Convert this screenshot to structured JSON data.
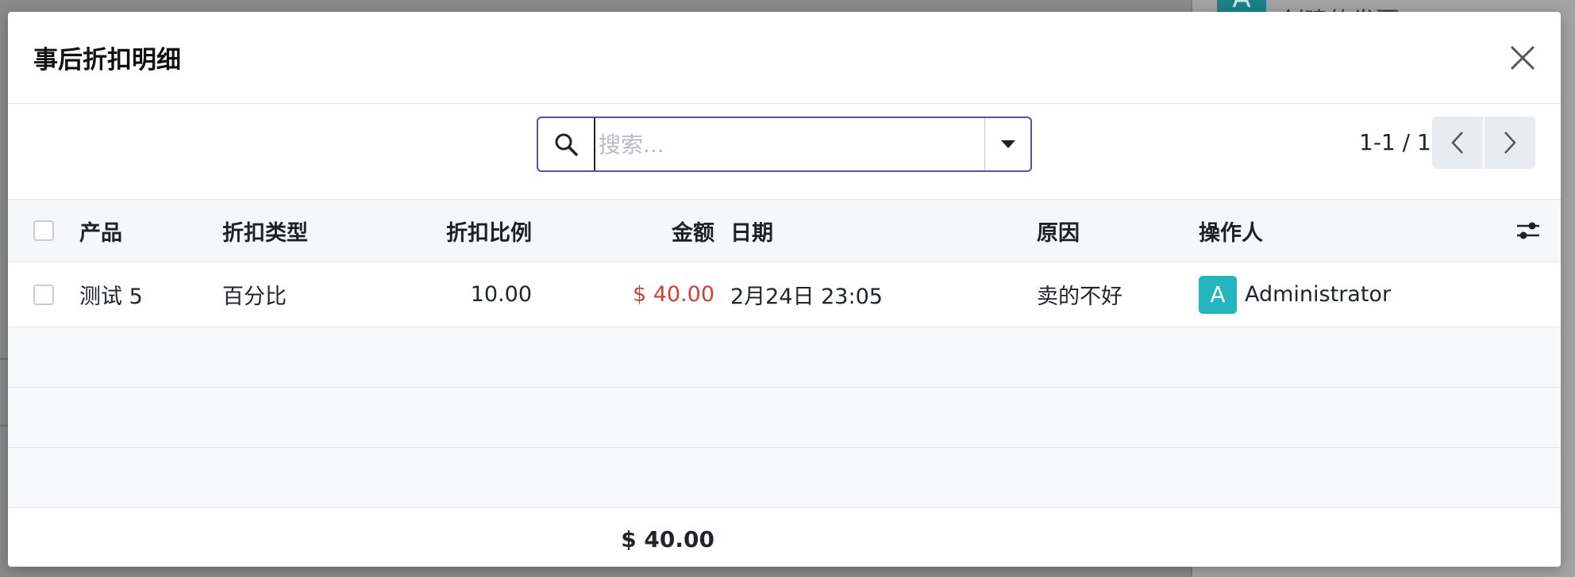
{
  "background": {
    "avatar_letter": "A",
    "partial_text": "创建的发票"
  },
  "modal": {
    "title": "事后折扣明细",
    "close_icon": "close-icon"
  },
  "search": {
    "placeholder": "搜索...",
    "value": "",
    "icon": "search-icon",
    "toggle_icon": "caret-down-icon"
  },
  "pager": {
    "value": "1-1 / 1",
    "prev_icon": "chevron-left-icon",
    "next_icon": "chevron-right-icon"
  },
  "table": {
    "headers": {
      "product": "产品",
      "type": "折扣类型",
      "ratio": "折扣比例",
      "amount": "金额",
      "date": "日期",
      "reason": "原因",
      "operator": "操作人"
    },
    "rows": [
      {
        "product": "测试 5",
        "type": "百分比",
        "ratio": "10.00",
        "amount": "$ 40.00",
        "date": "2月24日 23:05",
        "reason": "卖的不好",
        "operator_initial": "A",
        "operator": "Administrator"
      }
    ],
    "total_amount": "$ 40.00"
  },
  "colors": {
    "accent_border": "#5d4f9c",
    "amount_red": "#d23f3a",
    "avatar_teal": "#25b5bf"
  }
}
